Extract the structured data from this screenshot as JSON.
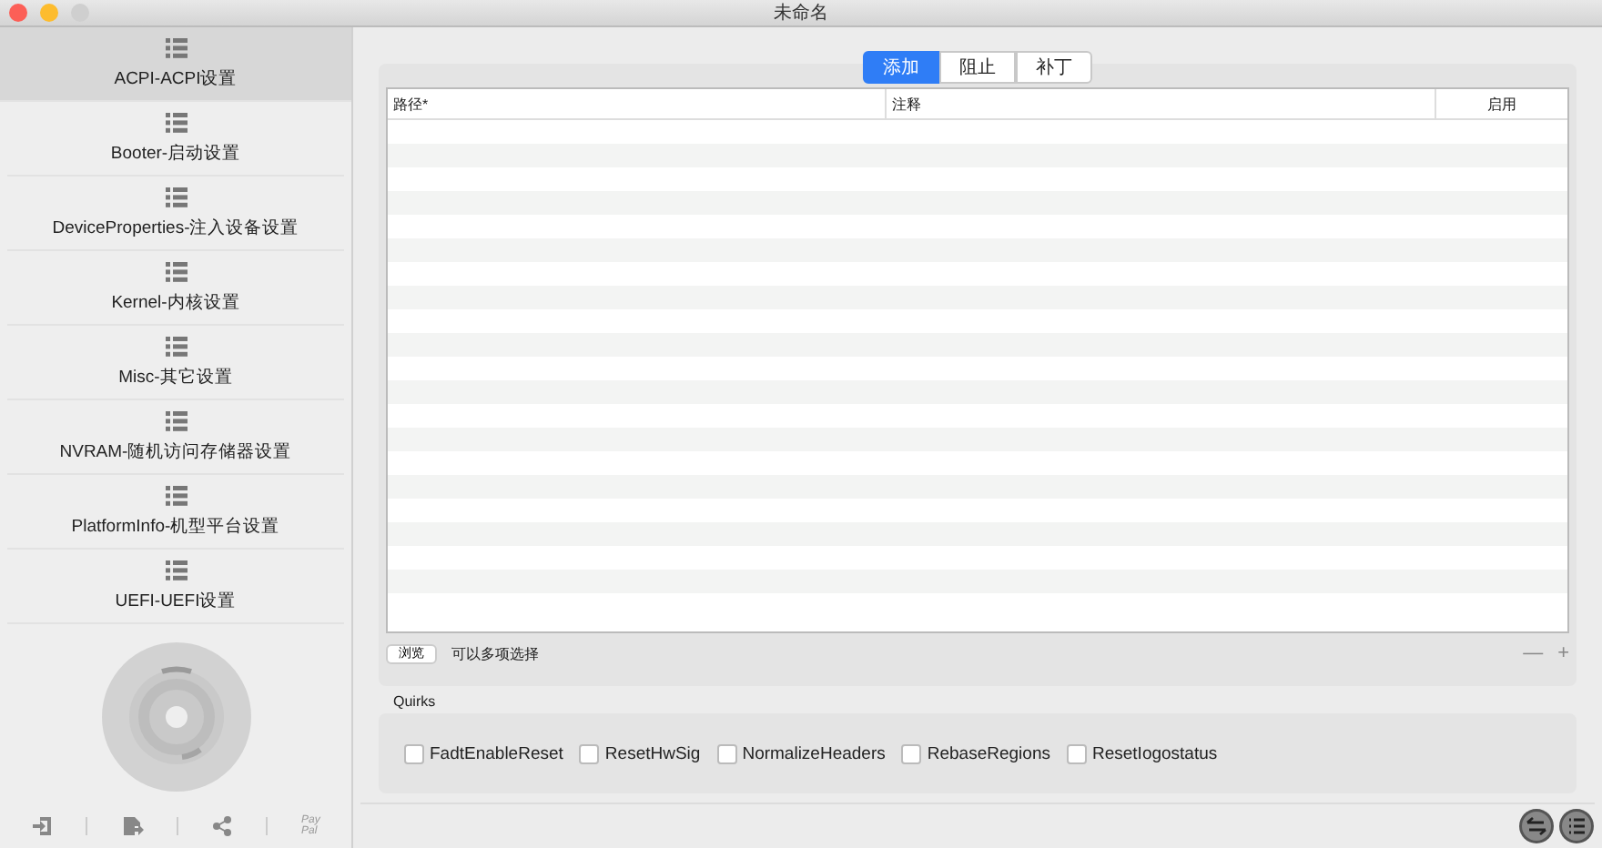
{
  "window": {
    "title": "未命名"
  },
  "sidebar": {
    "items": [
      {
        "label": "ACPI-ACPI设置",
        "selected": true
      },
      {
        "label": "Booter-启动设置",
        "selected": false
      },
      {
        "label": "DeviceProperties-注入设备设置",
        "selected": false
      },
      {
        "label": "Kernel-内核设置",
        "selected": false
      },
      {
        "label": "Misc-其它设置",
        "selected": false
      },
      {
        "label": "NVRAM-随机访问存储器设置",
        "selected": false
      },
      {
        "label": "PlatformInfo-机型平台设置",
        "selected": false
      },
      {
        "label": "UEFI-UEFI设置",
        "selected": false
      }
    ],
    "paypal": [
      "Pay",
      "Pal"
    ]
  },
  "tabs": [
    {
      "label": "添加",
      "selected": true
    },
    {
      "label": "阻止",
      "selected": false
    },
    {
      "label": "补丁",
      "selected": false
    }
  ],
  "table": {
    "columns": [
      "路径*",
      "注释",
      "启用"
    ]
  },
  "browse_button": "浏览",
  "hint": "可以多项选择",
  "add_remove": [
    "—",
    "+"
  ],
  "quirks": {
    "title": "Quirks",
    "items": [
      {
        "label": "FadtEnableReset",
        "checked": false
      },
      {
        "label": "ResetHwSig",
        "checked": false
      },
      {
        "label": "NormalizeHeaders",
        "checked": false
      },
      {
        "label": "RebaseRegions",
        "checked": false
      },
      {
        "label": "ResetIogostatus",
        "checked": false
      }
    ]
  }
}
